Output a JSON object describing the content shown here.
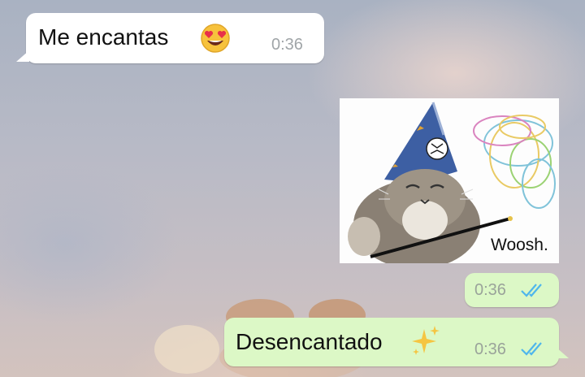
{
  "messages": [
    {
      "direction": "incoming",
      "text": "Me encantas",
      "emoji": "smiling-face-heart-eyes",
      "time": "0:36"
    },
    {
      "direction": "outgoing",
      "type": "sticker",
      "caption": "Woosh.",
      "time": "0:36",
      "status": "read"
    },
    {
      "direction": "outgoing",
      "text": "Desencantado",
      "emoji": "sparkles",
      "time": "0:36",
      "status": "read"
    }
  ],
  "colors": {
    "incoming_bubble": "#ffffff",
    "outgoing_bubble": "#dcf8c6",
    "read_ticks": "#4fb6ec",
    "timestamp": "#a0a5a8"
  }
}
